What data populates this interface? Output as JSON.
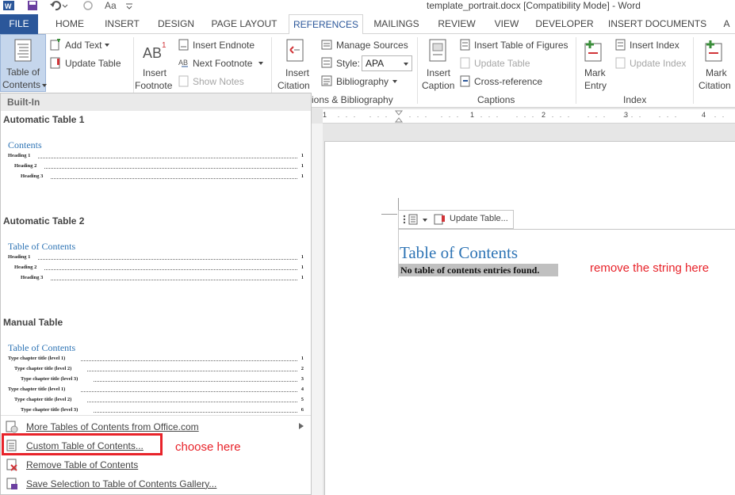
{
  "window": {
    "title": "template_portrait.docx [Compatibility Mode] - Word"
  },
  "qat": {
    "font_size_glyph": "Aa"
  },
  "tabs": [
    {
      "label": "FILE"
    },
    {
      "label": "HOME"
    },
    {
      "label": "INSERT"
    },
    {
      "label": "DESIGN"
    },
    {
      "label": "PAGE LAYOUT"
    },
    {
      "label": "REFERENCES"
    },
    {
      "label": "MAILINGS"
    },
    {
      "label": "REVIEW"
    },
    {
      "label": "VIEW"
    },
    {
      "label": "DEVELOPER"
    },
    {
      "label": "INSERT DOCUMENTS"
    },
    {
      "label": "A"
    }
  ],
  "ribbon": {
    "toc": {
      "line1": "Table of",
      "line2": "Contents"
    },
    "add_text": "Add Text",
    "update_table": "Update Table",
    "insert_footnote": {
      "glyph": "AB",
      "sup": "1",
      "line1": "Insert",
      "line2": "Footnote"
    },
    "insert_endnote": "Insert Endnote",
    "next_footnote": "Next Footnote",
    "show_notes": "Show Notes",
    "insert_citation": {
      "line1": "Insert",
      "line2": "Citation"
    },
    "manage_sources": "Manage Sources",
    "style_label": "Style:",
    "style_value": "APA",
    "bibliography": "Bibliography",
    "group_citations": "ions & Bibliography",
    "insert_caption": {
      "line1": "Insert",
      "line2": "Caption"
    },
    "insert_table_figures": "Insert Table of Figures",
    "update_table_captions": "Update Table",
    "cross_reference": "Cross-reference",
    "group_captions": "Captions",
    "mark_entry": {
      "line1": "Mark",
      "line2": "Entry"
    },
    "insert_index": "Insert Index",
    "update_index": "Update Index",
    "group_index": "Index",
    "mark_citation": {
      "line1": "Mark",
      "line2": "Citation"
    }
  },
  "dropdown": {
    "header": "Built-In",
    "sections": [
      {
        "name": "Automatic Table 1",
        "toc_title": "Contents",
        "rows": [
          {
            "text": "Heading 1",
            "page": "1"
          },
          {
            "text": "Heading 2",
            "page": "1"
          },
          {
            "text": "Heading 3",
            "page": "1"
          }
        ]
      },
      {
        "name": "Automatic Table 2",
        "toc_title": "Table of Contents",
        "rows": [
          {
            "text": "Heading 1",
            "page": "1"
          },
          {
            "text": "Heading 2",
            "page": "1"
          },
          {
            "text": "Heading 3",
            "page": "1"
          }
        ]
      },
      {
        "name": "Manual Table",
        "toc_title": "Table of Contents",
        "rows": [
          {
            "text": "Type chapter title (level 1)",
            "page": "1"
          },
          {
            "text": "Type chapter title (level 2)",
            "page": "2"
          },
          {
            "text": "Type chapter title (level 3)",
            "page": "3"
          },
          {
            "text": "Type chapter title (level 1)",
            "page": "4"
          },
          {
            "text": "Type chapter title (level 2)",
            "page": "5"
          },
          {
            "text": "Type chapter title (level 3)",
            "page": "6"
          }
        ]
      }
    ],
    "menu": [
      {
        "label": "More Tables of Contents from Office.com"
      },
      {
        "label": "Custom Table of Contents..."
      },
      {
        "label": "Remove Table of Contents"
      },
      {
        "label": "Save Selection to Table of Contents Gallery..."
      }
    ]
  },
  "annotations": {
    "choose": "choose here",
    "remove": "remove the string here"
  },
  "document": {
    "ruler_numbers": [
      "1",
      "1",
      "2",
      "3",
      "4"
    ],
    "control_update": "Update Table...",
    "toc_heading": "Table of Contents",
    "toc_empty": "No table of contents entries found."
  },
  "colors": {
    "accent": "#2b579a",
    "toc_blue": "#2e74b5",
    "annotation_red": "#e8232a"
  }
}
